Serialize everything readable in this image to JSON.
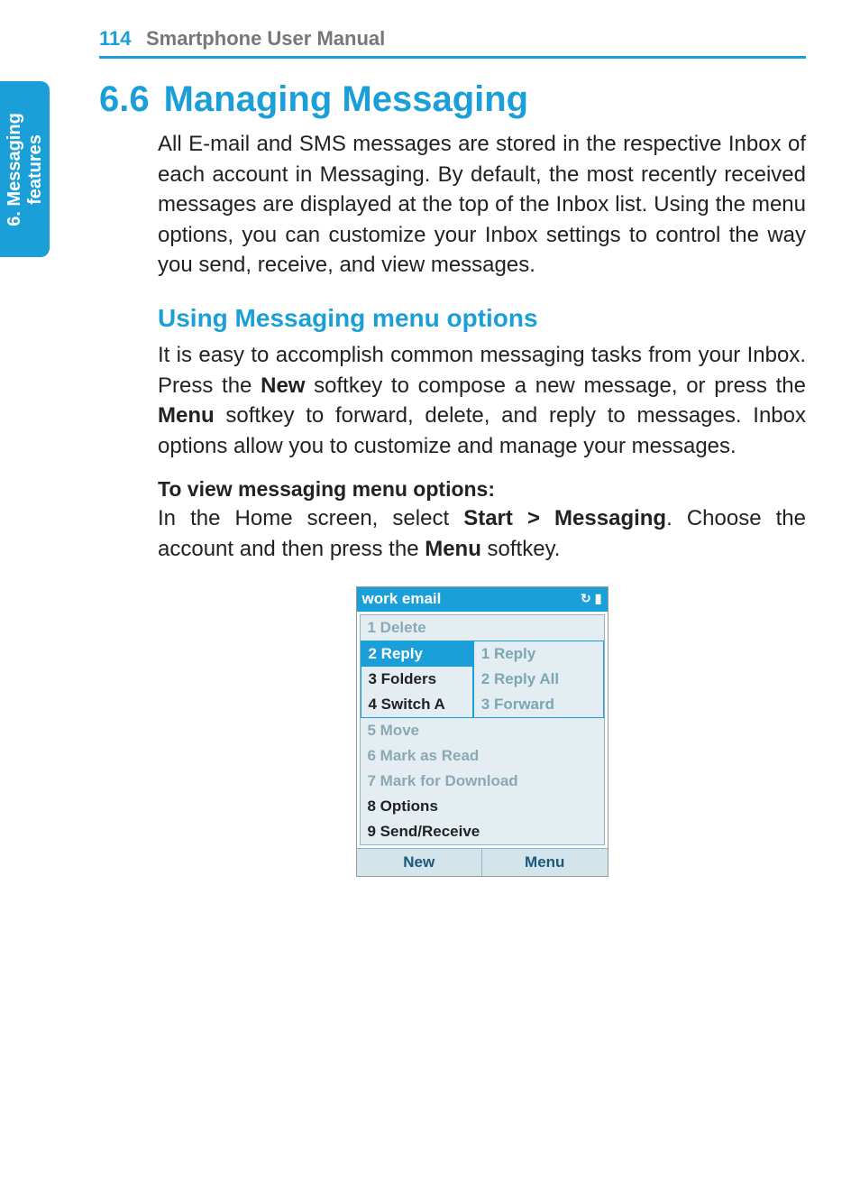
{
  "header": {
    "page_number": "114",
    "manual_title": "Smartphone User Manual"
  },
  "side_tab": {
    "line1": "6. Messaging",
    "line2": "features"
  },
  "section": {
    "number": "6.6",
    "title": "Managing Messaging",
    "intro_paragraph": "All E-mail and SMS messages are stored in the respective Inbox of each account in Messaging.  By default, the most recently received messages are displayed at the top of the Inbox list.  Using the menu options, you can customize your Inbox settings to control the way you send, receive, and view messages."
  },
  "subsection": {
    "title": "Using Messaging menu options",
    "paragraph_1_a": "It is easy to accomplish common messaging tasks from your Inbox.  Press the ",
    "paragraph_1_b": "New",
    "paragraph_1_c": " softkey to compose a new message, or press the ",
    "paragraph_1_d": "Menu",
    "paragraph_1_e": " softkey to forward, delete, and reply to messages.  Inbox options allow you to customize and man­age your messages.",
    "instruction_title": "To view messaging menu options:",
    "instruction_a": "In the Home screen, select ",
    "instruction_b": "Start > Messaging",
    "instruction_c": ".  Choose the account and then press the ",
    "instruction_d": "Menu",
    "instruction_e": " softkey."
  },
  "phone": {
    "title": "work email",
    "status_icon_1": "↻",
    "status_icon_2": "▮",
    "menu": {
      "item1": "1 Delete",
      "item2": "2 Reply",
      "item2_sub1": "1 Reply",
      "item2_sub2": "2 Reply All",
      "item2_sub3": "3 Forward",
      "item3": "3 Folders",
      "item4": "4 Switch A",
      "item5": "5 Move",
      "item6": "6 Mark as Read",
      "item7": "7 Mark for Download",
      "item8": "8 Options",
      "item9": "9 Send/Receive"
    },
    "softkey_left": "New",
    "softkey_right": "Menu"
  }
}
